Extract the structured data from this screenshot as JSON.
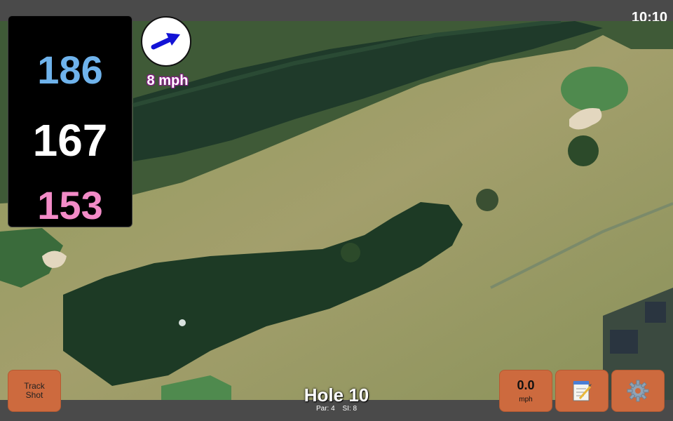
{
  "status": {
    "time": "10:10"
  },
  "distances": {
    "back": "186",
    "middle": "167",
    "front": "153"
  },
  "wind": {
    "speed_label": "8 mph",
    "direction_icon": "wind-arrow-icon"
  },
  "track_button": {
    "line1": "Track",
    "line2": "Shot"
  },
  "speed_button": {
    "value": "0.0",
    "unit": "mph"
  },
  "notes_button": {
    "icon": "notepad-icon"
  },
  "settings_button": {
    "icon": "gear-icon"
  },
  "hole": {
    "title": "Hole 10",
    "par": "Par: 4",
    "si": "SI: 8"
  },
  "colors": {
    "back": "#6fb3ec",
    "middle": "#ffffff",
    "front": "#f28bc7",
    "button": "#cd6a3e",
    "accent": "#8a1a8a"
  }
}
